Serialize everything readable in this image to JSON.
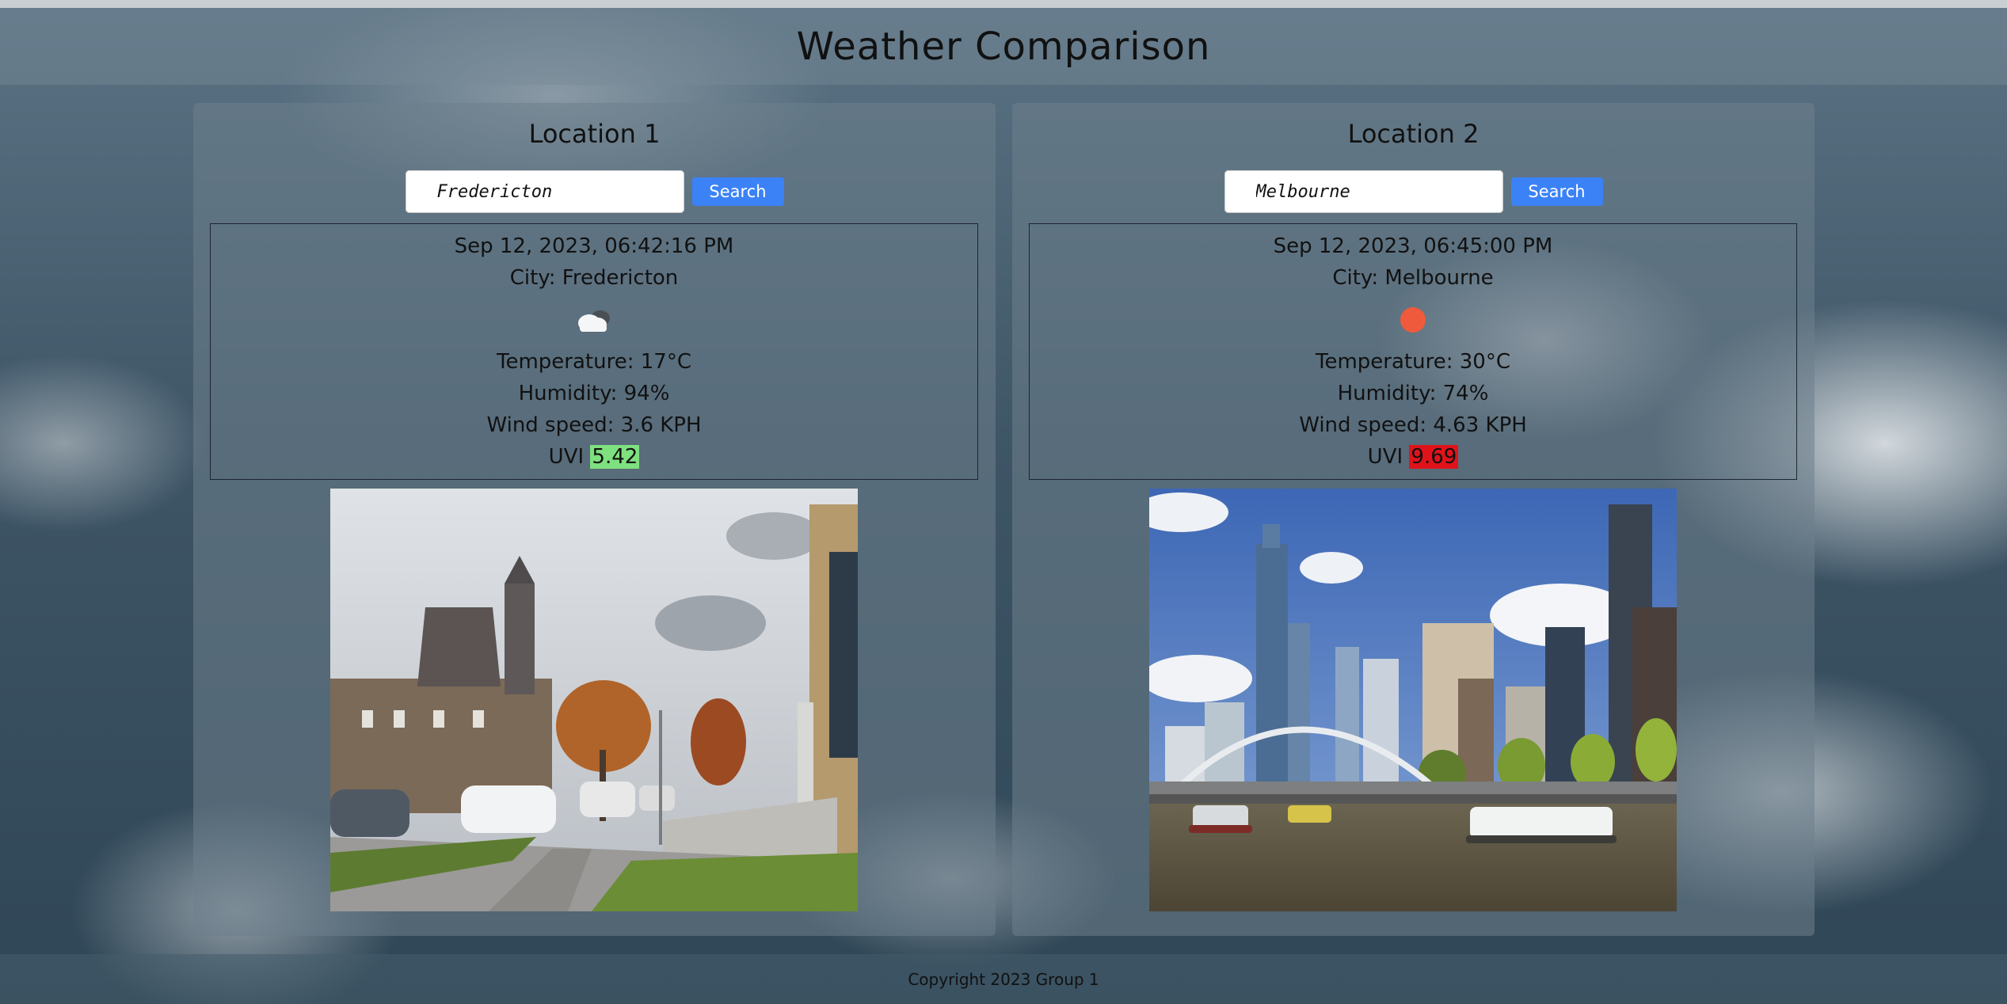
{
  "header": {
    "title": "Weather Comparison"
  },
  "locations": [
    {
      "title": "Location 1",
      "search": {
        "value": "Fredericton",
        "button": "Search"
      },
      "weather": {
        "datetime": "Sep 12, 2023, 06:42:16 PM",
        "city": "City: Fredericton",
        "icon": "cloud-icon",
        "temperature": "Temperature: 17°C",
        "humidity": "Humidity: 94%",
        "wind": "Wind speed: 3.6 KPH",
        "uvi_label": "UVI",
        "uvi_value": "5.42",
        "uvi_color": "#7fe07f"
      },
      "photo": "city-photo-fredericton"
    },
    {
      "title": "Location 2",
      "search": {
        "value": "Melbourne",
        "button": "Search"
      },
      "weather": {
        "datetime": "Sep 12, 2023, 06:45:00 PM",
        "city": "City: Melbourne",
        "icon": "sun-icon",
        "temperature": "Temperature: 30°C",
        "humidity": "Humidity: 74%",
        "wind": "Wind speed: 4.63 KPH",
        "uvi_label": "UVI",
        "uvi_value": "9.69",
        "uvi_color": "#e0131b"
      },
      "photo": "city-photo-melbourne"
    }
  ],
  "footer": {
    "text": "Copyright 2023 Group 1"
  },
  "colors": {
    "search_button": "#3b82f6",
    "sun": "#f05a3c"
  }
}
